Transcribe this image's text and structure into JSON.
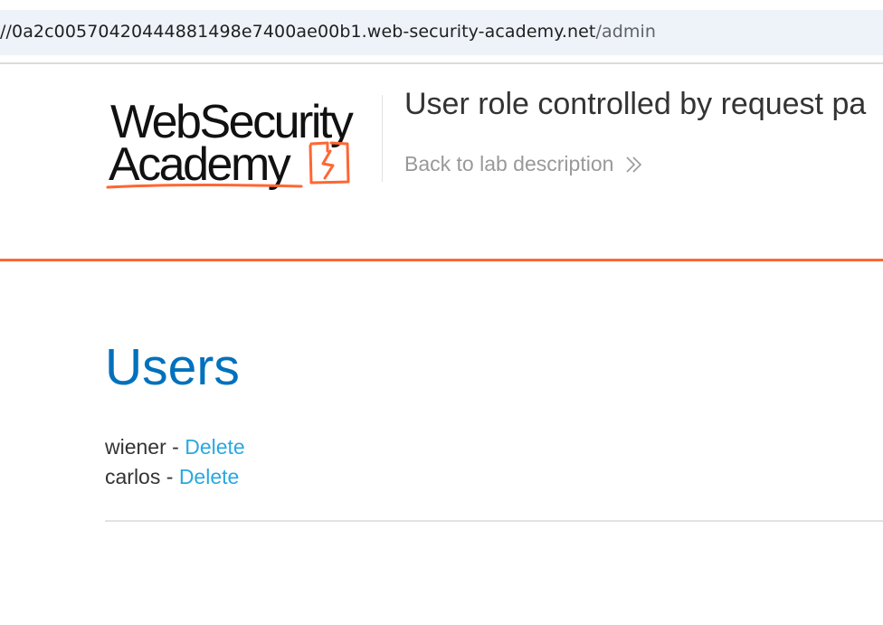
{
  "browser": {
    "url_host": "//0a2c00570420444881498e7400ae00b1.web-security-academy.net",
    "url_path": "/admin"
  },
  "header": {
    "logo_line1": "WebSecurity",
    "logo_line2": "Academy",
    "lab_title": "User role controlled by request pa",
    "back_link": "Back to lab description",
    "accent_color": "#ff6633"
  },
  "main": {
    "heading": "Users",
    "users": [
      {
        "name": "wiener",
        "separator": " - ",
        "action": "Delete"
      },
      {
        "name": "carlos",
        "separator": " - ",
        "action": "Delete"
      }
    ]
  },
  "colors": {
    "heading": "#0071bc",
    "link": "#29a8e0",
    "muted": "#999999"
  },
  "icons": {
    "logo_mark": "lightning-bolt-icon",
    "back_chevron": "double-chevron-right-icon"
  }
}
